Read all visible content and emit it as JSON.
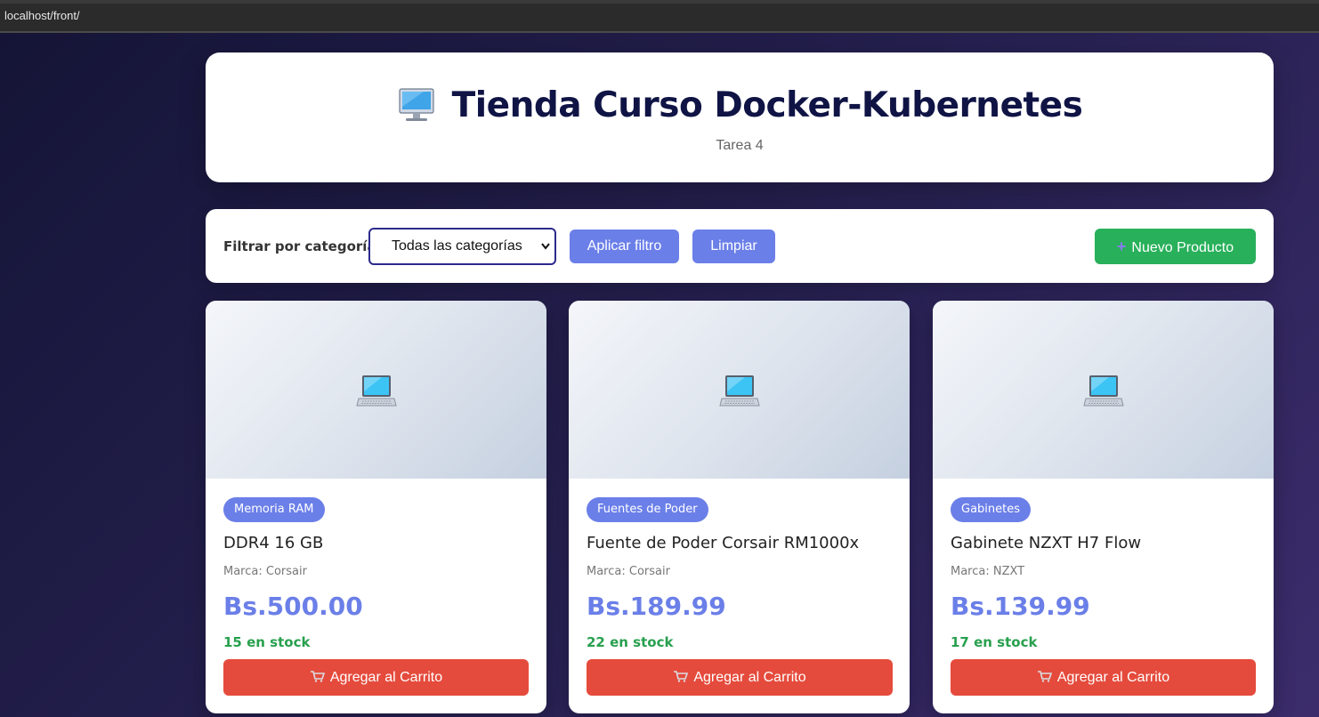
{
  "browser": {
    "url": "localhost/front/"
  },
  "header": {
    "title": "Tienda Curso Docker-Kubernetes",
    "subtitle": "Tarea 4"
  },
  "filter": {
    "label": "Filtrar por categoría:",
    "selected": "Todas las categorías",
    "apply_label": "Aplicar filtro",
    "clear_label": "Limpiar",
    "new_label": "Nuevo Producto"
  },
  "products": [
    {
      "category": "Memoria RAM",
      "name": "DDR4 16 GB",
      "brand": "Marca: Corsair",
      "price": "Bs.500.00",
      "stock": "15 en stock",
      "cart_label": "Agregar al Carrito"
    },
    {
      "category": "Fuentes de Poder",
      "name": "Fuente de Poder Corsair RM1000x",
      "brand": "Marca: Corsair",
      "price": "Bs.189.99",
      "stock": "22 en stock",
      "cart_label": "Agregar al Carrito"
    },
    {
      "category": "Gabinetes",
      "name": "Gabinete NZXT H7 Flow",
      "brand": "Marca: NZXT",
      "price": "Bs.139.99",
      "stock": "17 en stock",
      "cart_label": "Agregar al Carrito"
    }
  ],
  "icons": {
    "header": "desktop-computer-icon",
    "product": "laptop-icon",
    "new": "plus-icon",
    "cart": "shopping-cart-icon"
  },
  "colors": {
    "primary": "#6b7fe8",
    "success": "#28b05a",
    "danger": "#e54b3c",
    "title": "#0f1445"
  }
}
